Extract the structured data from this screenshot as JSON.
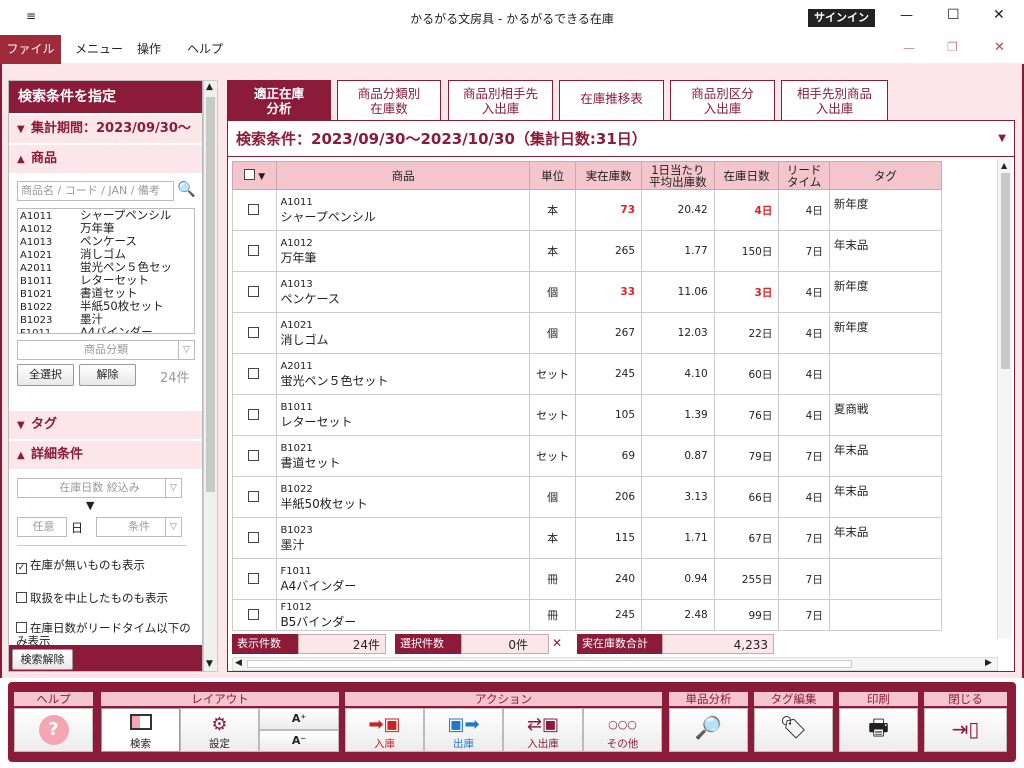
{
  "window": {
    "title": "かるがる文房具 - かるがるできる在庫",
    "signin": "サインイン",
    "quick_access": "≡",
    "controls": {
      "minimize": "—",
      "maximize": "☐",
      "close": "✕"
    }
  },
  "menu": {
    "file": "ファイル",
    "menu": "メニュー",
    "operation": "操作",
    "help": "ヘルプ"
  },
  "left": {
    "header": "検索条件を指定",
    "period": "集計期間：2023/09/30〜",
    "product_section": "商品",
    "search_placeholder": "商品名 / コード / JAN / 備考",
    "products": [
      {
        "code": "A1011",
        "name": "シャープペンシル"
      },
      {
        "code": "A1012",
        "name": "万年筆"
      },
      {
        "code": "A1013",
        "name": "ペンケース"
      },
      {
        "code": "A1021",
        "name": "消しゴム"
      },
      {
        "code": "A2011",
        "name": "蛍光ペン５色セッ"
      },
      {
        "code": "B1011",
        "name": "レターセット"
      },
      {
        "code": "B1021",
        "name": "書道セット"
      },
      {
        "code": "B1022",
        "name": "半紙50枚セット"
      },
      {
        "code": "B1023",
        "name": "墨汁"
      },
      {
        "code": "F1011",
        "name": "A4バインダー"
      }
    ],
    "category_select": "商品分類",
    "select_all": "全選択",
    "clear": "解除",
    "count": "24件",
    "tag_section": "タグ",
    "detail_section": "詳細条件",
    "days_filter": "在庫日数 絞込み",
    "arrow": "▼",
    "any": "任意",
    "day_unit": "日",
    "condition": "条件",
    "checks": [
      {
        "label": "在庫が無いものも表示",
        "checked": true
      },
      {
        "label": "取扱を中止したものも表示",
        "checked": false
      },
      {
        "label": "在庫日数がリードタイム以下のみ表示",
        "checked": false
      }
    ],
    "search_clear": "検索解除"
  },
  "tabs": [
    {
      "label1": "適正在庫",
      "label2": "分析",
      "active": true
    },
    {
      "label1": "商品分類別",
      "label2": "在庫数"
    },
    {
      "label1": "商品別相手先",
      "label2": "入出庫"
    },
    {
      "label1": "在庫推移表",
      "label2": ""
    },
    {
      "label1": "商品別区分",
      "label2": "入出庫"
    },
    {
      "label1": "相手先別商品",
      "label2": "入出庫"
    }
  ],
  "criteria": "検索条件：2023/09/30〜2023/10/30（集計日数:31日）",
  "columns": {
    "product": "商品",
    "unit": "単位",
    "stock": "実在庫数",
    "daily1": "1日当たり",
    "daily2": "平均出庫数",
    "days": "在庫日数",
    "lead1": "リード",
    "lead2": "タイム",
    "tag": "タグ"
  },
  "rows": [
    {
      "code": "A1011",
      "name": "シャープペンシル",
      "unit": "本",
      "stock": "73",
      "avg": "20.42",
      "days": "4日",
      "lead": "4日",
      "tag": "新年度",
      "alert": true
    },
    {
      "code": "A1012",
      "name": "万年筆",
      "unit": "本",
      "stock": "265",
      "avg": "1.77",
      "days": "150日",
      "lead": "7日",
      "tag": "年末品",
      "alert": false
    },
    {
      "code": "A1013",
      "name": "ペンケース",
      "unit": "個",
      "stock": "33",
      "avg": "11.06",
      "days": "3日",
      "lead": "4日",
      "tag": "新年度",
      "alert": true
    },
    {
      "code": "A1021",
      "name": "消しゴム",
      "unit": "個",
      "stock": "267",
      "avg": "12.03",
      "days": "22日",
      "lead": "4日",
      "tag": "新年度",
      "alert": false
    },
    {
      "code": "A2011",
      "name": "蛍光ペン５色セット",
      "unit": "セット",
      "stock": "245",
      "avg": "4.10",
      "days": "60日",
      "lead": "4日",
      "tag": "",
      "alert": false
    },
    {
      "code": "B1011",
      "name": "レターセット",
      "unit": "セット",
      "stock": "105",
      "avg": "1.39",
      "days": "76日",
      "lead": "4日",
      "tag": "夏商戦",
      "alert": false
    },
    {
      "code": "B1021",
      "name": "書道セット",
      "unit": "セット",
      "stock": "69",
      "avg": "0.87",
      "days": "79日",
      "lead": "7日",
      "tag": "年末品",
      "alert": false
    },
    {
      "code": "B1022",
      "name": "半紙50枚セット",
      "unit": "個",
      "stock": "206",
      "avg": "3.13",
      "days": "66日",
      "lead": "4日",
      "tag": "年末品",
      "alert": false
    },
    {
      "code": "B1023",
      "name": "墨汁",
      "unit": "本",
      "stock": "115",
      "avg": "1.71",
      "days": "67日",
      "lead": "7日",
      "tag": "年末品",
      "alert": false
    },
    {
      "code": "F1011",
      "name": "A4バインダー",
      "unit": "冊",
      "stock": "240",
      "avg": "0.94",
      "days": "255日",
      "lead": "7日",
      "tag": "",
      "alert": false
    },
    {
      "code": "F1012",
      "name": "B5バインダー",
      "unit": "冊",
      "stock": "245",
      "avg": "2.48",
      "days": "99日",
      "lead": "7日",
      "tag": "",
      "alert": false
    }
  ],
  "status": {
    "display_label": "表示件数",
    "display_value": "24件",
    "selected_label": "選択件数",
    "selected_value": "0件",
    "total_label": "実在庫数合計",
    "total_value": "4,233",
    "clear_icon": "✕"
  },
  "toolbar": {
    "help_group": "ヘルプ",
    "help_icon": "?",
    "layout_group": "レイアウト",
    "search": "検索",
    "settings": "設定",
    "font_up": "A⁺",
    "font_down": "A⁻",
    "action_group": "アクション",
    "in": "入庫",
    "out": "出庫",
    "inout": "入出庫",
    "other": "その他",
    "other_icon": "○○○",
    "analysis_group": "単品分析",
    "tag_edit_group": "タグ編集",
    "print_group": "印刷",
    "close_group": "閉じる"
  },
  "colors": {
    "accent": "#8c1b3a",
    "alert": "#dd2222",
    "panel": "#fbe7ea"
  }
}
